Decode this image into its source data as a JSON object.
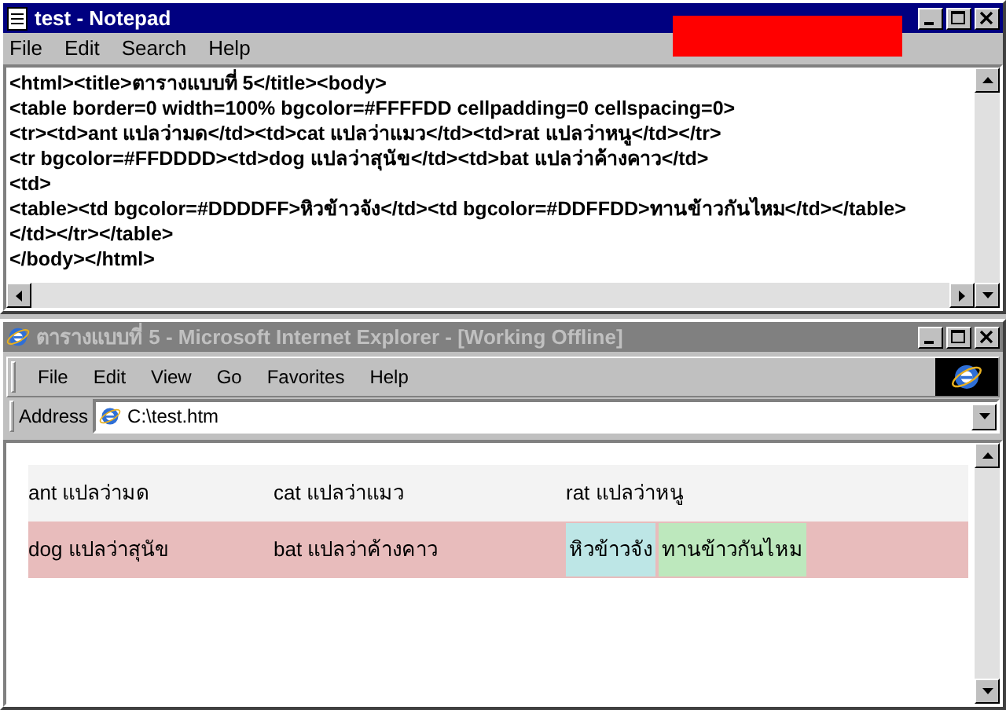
{
  "notepad": {
    "title": "test - Notepad",
    "menu": [
      "File",
      "Edit",
      "Search",
      "Help"
    ],
    "lines": [
      "<html><title>ตารางแบบที่ 5</title><body>",
      "<table border=0 width=100% bgcolor=#FFFFDD cellpadding=0 cellspacing=0>",
      "<tr><td>ant แปลว่ามด</td><td>cat แปลว่าแมว</td><td>rat แปลว่าหนู</td></tr>",
      "<tr bgcolor=#FFDDDD><td>dog แปลว่าสุนัข</td><td>bat แปลว่าค้างคาว</td>",
      "<td>",
      "<table><td bgcolor=#DDDDFF>หิวข้าวจัง</td><td bgcolor=#DDFFDD>ทานข้าวกันไหม</td></table>",
      "</td></tr></table>",
      "</body></html>"
    ]
  },
  "browser": {
    "title": "ตารางแบบที่ 5 - Microsoft Internet Explorer - [Working Offline]",
    "menu": [
      "File",
      "Edit",
      "View",
      "Go",
      "Favorites",
      "Help"
    ],
    "address_label": "Address",
    "address": "C:\\test.htm",
    "rows": [
      {
        "color": "#f3f3f3",
        "cells": [
          "ant แปลว่ามด",
          "cat แปลว่าแมว",
          "rat แปลว่าหนู"
        ]
      },
      {
        "color": "#e8bcbc",
        "cells": [
          "dog แปลว่าสุนัข",
          "bat แปลว่าค้างคาว"
        ],
        "inner": [
          {
            "text": "หิวข้าวจัง",
            "color": "#bde6e6"
          },
          {
            "text": "ทานข้าวกันไหม",
            "color": "#bde8bd"
          }
        ]
      }
    ]
  }
}
